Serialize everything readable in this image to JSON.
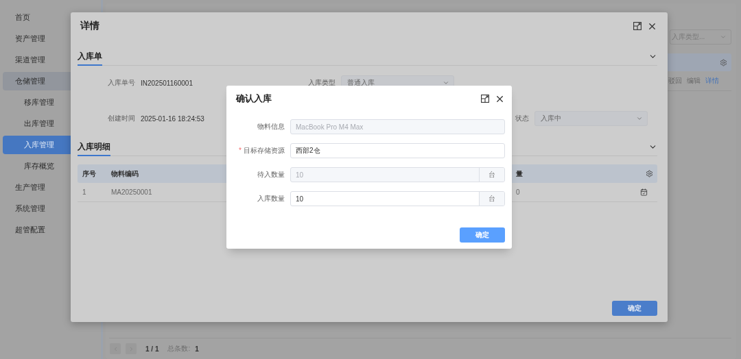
{
  "sidebar": {
    "items": [
      {
        "label": "首页",
        "selected": false
      },
      {
        "label": "资产管理",
        "selected": false
      },
      {
        "label": "渠道管理",
        "selected": false
      },
      {
        "label": "仓储管理",
        "selected": false,
        "expanded": true,
        "children": [
          {
            "label": "移库管理",
            "selected": false
          },
          {
            "label": "出库管理",
            "selected": false
          },
          {
            "label": "入库管理",
            "selected": true
          },
          {
            "label": "库存概览",
            "selected": false
          }
        ]
      },
      {
        "label": "生产管理",
        "selected": false
      },
      {
        "label": "系统管理",
        "selected": false
      },
      {
        "label": "超管配置",
        "selected": false
      }
    ]
  },
  "list_page": {
    "type_filter": {
      "placeholder": "入库类型..."
    },
    "row_actions": [
      {
        "label": "驳回",
        "kind": "text"
      },
      {
        "label": "编辑",
        "kind": "text"
      },
      {
        "label": "详情",
        "kind": "link"
      }
    ],
    "pagination": {
      "page": "1 / 1",
      "total_label": "总条数:",
      "total": "1"
    }
  },
  "detail_dialog": {
    "title": "详情",
    "sections": [
      {
        "title": "入库单",
        "expanded": true,
        "form_rows": [
          [
            {
              "label": "入库单号",
              "value": "IN202501160001",
              "kind": "text"
            },
            {
              "label": "入库类型",
              "value": "普通入库",
              "kind": "select"
            }
          ],
          [
            {
              "label": "创建时间",
              "value": "2025-01-16 18:24:53",
              "kind": "text"
            },
            {
              "label": "状态",
              "value": "入库中",
              "kind": "select"
            }
          ]
        ]
      },
      {
        "title": "入库明细",
        "expanded": true,
        "table": {
          "columns": [
            "序号",
            "物料编码",
            "量"
          ],
          "rows": [
            [
              "1",
              "MA20250001",
              "0"
            ]
          ]
        }
      }
    ],
    "confirm_button": "确定"
  },
  "confirm_dialog": {
    "title": "确认入库",
    "fields": [
      {
        "label": "物料信息",
        "value": "MacBook Pro M4 Max",
        "disabled": true
      },
      {
        "label": "目标存储资源",
        "value": "西部2仓",
        "required_mark": "*",
        "disabled": false
      },
      {
        "label": "待入数量",
        "value": "10",
        "unit": "台",
        "disabled": true
      },
      {
        "label": "入库数量",
        "value": "10",
        "unit": "台",
        "disabled": false
      }
    ],
    "confirm_button": "确定"
  }
}
